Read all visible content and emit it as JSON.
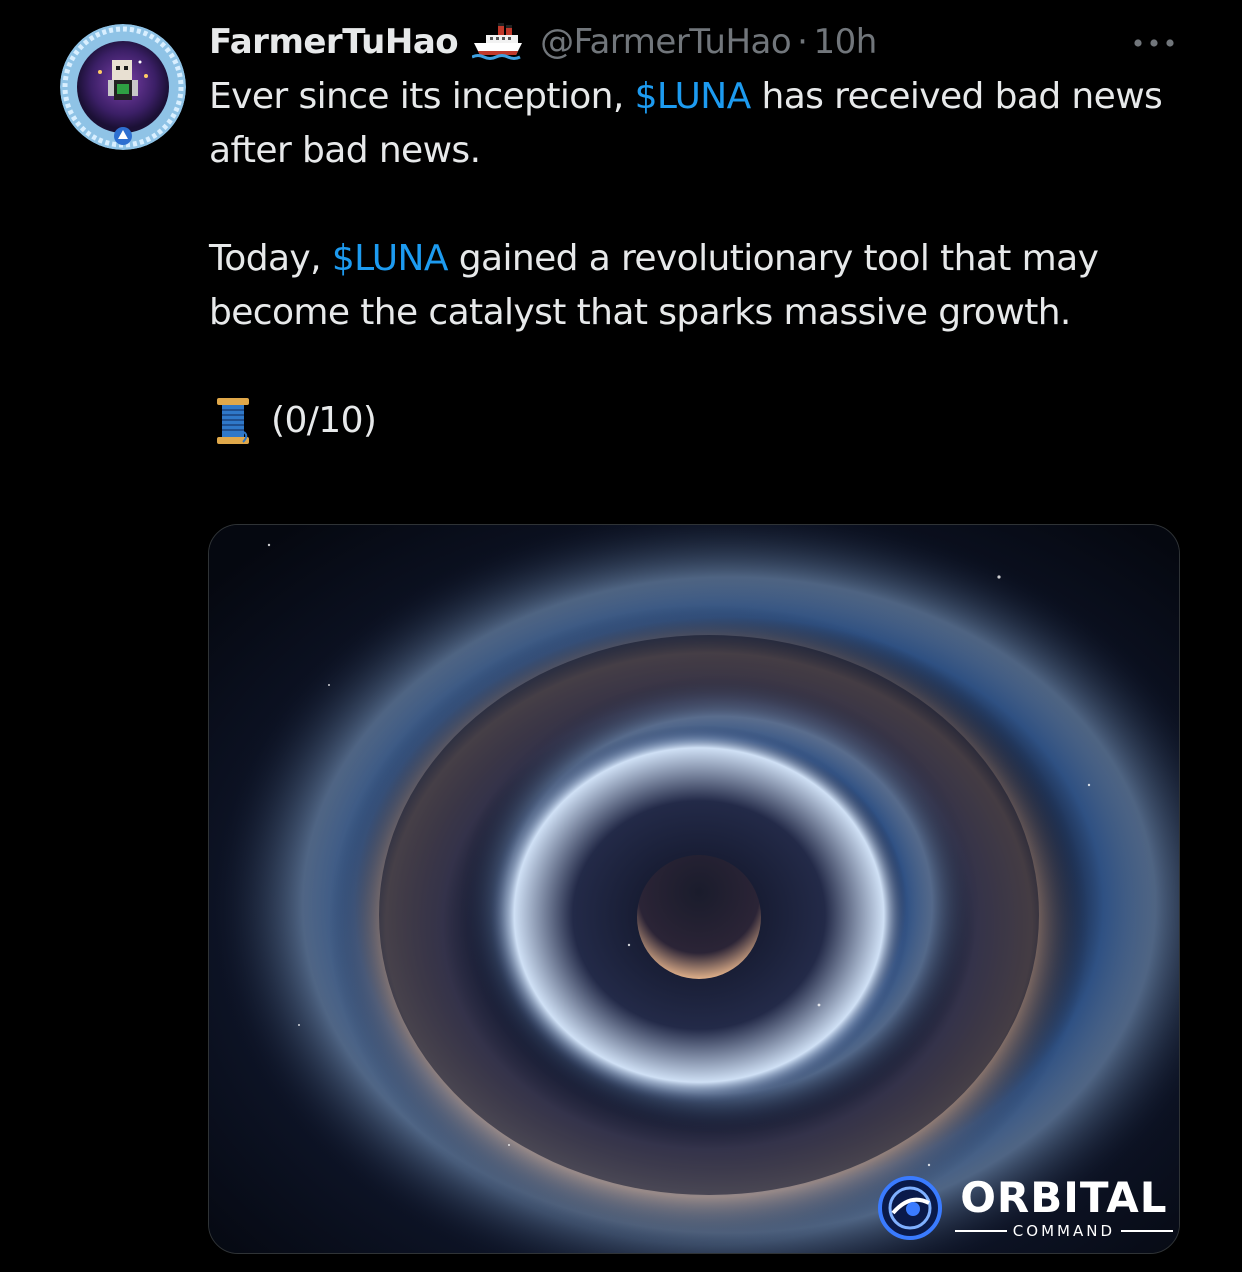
{
  "tweet": {
    "display_name": "FarmerTuHao",
    "badge_icon": "ship-emoji",
    "handle": "@FarmerTuHao",
    "separator": "·",
    "time": "10h",
    "more_icon": "more-horizontal-icon",
    "paragraphs": [
      {
        "before": "Ever since its inception, ",
        "cashtag": "$LUNA",
        "after": " has received bad news after bad news."
      },
      {
        "before": "Today, ",
        "cashtag": "$LUNA",
        "after": " gained a revolutionary tool that may become the catalyst that sparks massive growth."
      }
    ],
    "thread_icon": "thread-spool-emoji",
    "thread_counter": "(0/10)"
  },
  "media": {
    "description_icon": "space-vortex-image",
    "logo": {
      "word": "ORBITAL",
      "sub": "COMMAND"
    }
  },
  "colors": {
    "background": "#000000",
    "text": "#e7e9ea",
    "muted": "#71767b",
    "link": "#1d9bf0"
  }
}
